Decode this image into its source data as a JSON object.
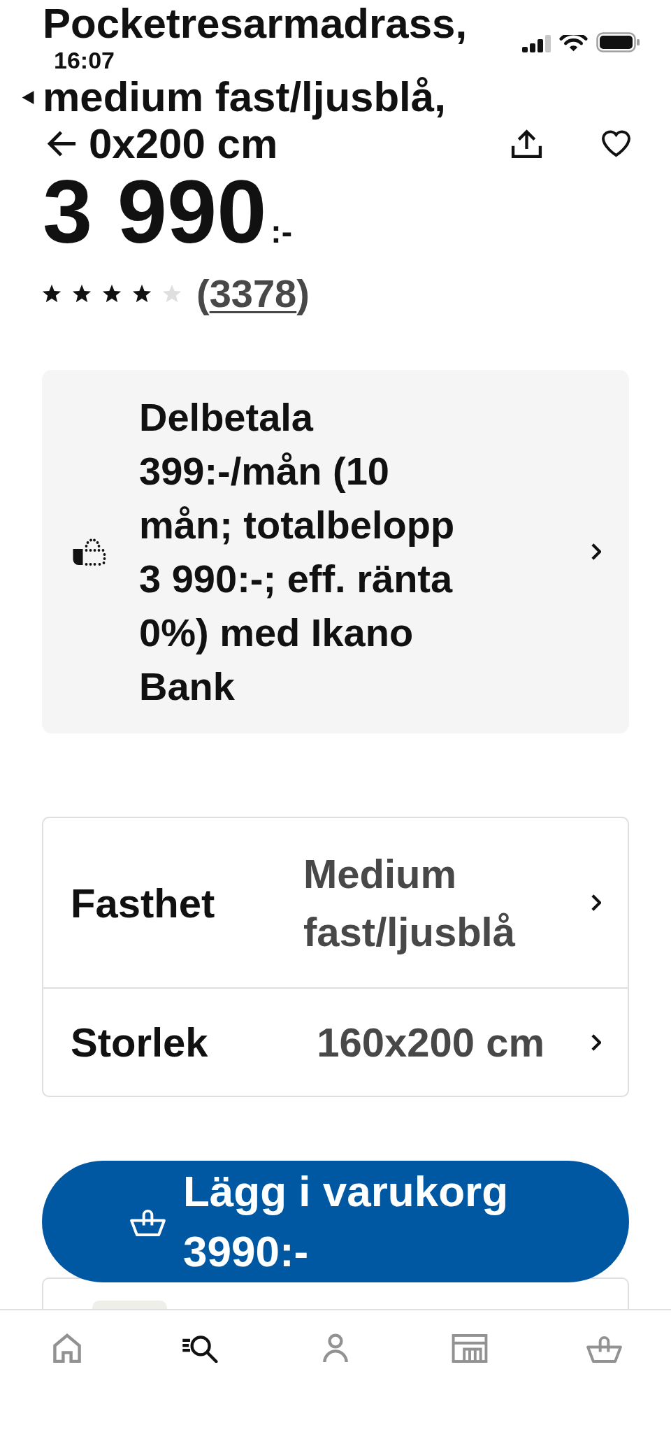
{
  "status_bar": {
    "time": "16:07"
  },
  "title_lines": [
    "Pocketresarmadrass,",
    "medium fast/ljusblå,",
    "0x200 cm"
  ],
  "price": {
    "amount": "3 990",
    "suffix": ":-"
  },
  "rating": {
    "stars": 4,
    "open": "(",
    "count": "3378",
    "close": ")"
  },
  "installment": {
    "text": "Delbetala 399:-/mån (10 mån; totalbelopp 3 990:-; eff. ränta 0%) med Ikano Bank"
  },
  "options": [
    {
      "label": "Fasthet",
      "value": "Medium fast/ljusblå"
    },
    {
      "label": "Storlek",
      "value": "160x200 cm"
    }
  ],
  "add_to_cart": {
    "label": "Lägg i varukorg 3990:-"
  },
  "bottom_nav": [
    {
      "kind": "home",
      "selected": false
    },
    {
      "kind": "search",
      "selected": true
    },
    {
      "kind": "profile",
      "selected": false
    },
    {
      "kind": "store",
      "selected": false
    },
    {
      "kind": "cart",
      "selected": false
    }
  ]
}
